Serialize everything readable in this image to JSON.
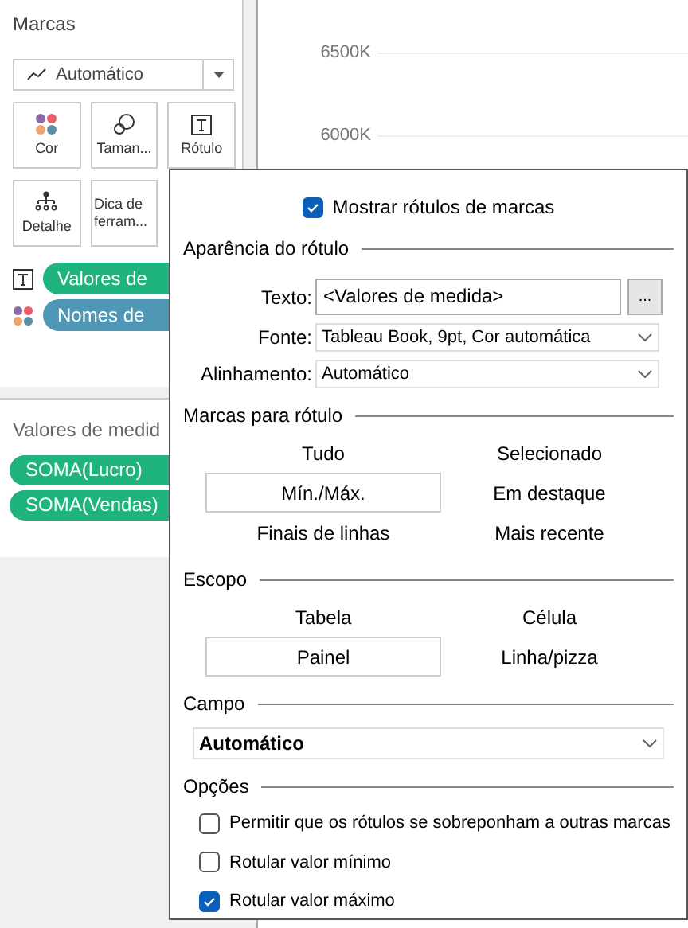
{
  "marks_panel": {
    "title": "Marcas",
    "mark_type": "Automático",
    "cards": [
      {
        "kind": "color",
        "label": "Cor"
      },
      {
        "kind": "size",
        "label": "Taman..."
      },
      {
        "kind": "label",
        "label": "Rótulo"
      },
      {
        "kind": "detail",
        "label": "Detalhe"
      },
      {
        "kind": "tooltip",
        "label": "Dica de ferram..."
      }
    ],
    "fields": [
      {
        "kind": "label",
        "text": "Valores de",
        "color": "#1fb37e"
      },
      {
        "kind": "color",
        "text": "Nomes de",
        "color": "#4f97b5"
      }
    ]
  },
  "measure_values": {
    "title": "Valores de medid",
    "pills": [
      "SOMA(Lucro)",
      "SOMA(Vendas)"
    ]
  },
  "axis_labels": [
    "6500K",
    "6000K"
  ],
  "popup": {
    "show_labels": {
      "label": "Mostrar rótulos de marcas",
      "checked": true
    },
    "appearance": {
      "title": "Aparência do rótulo",
      "text_label": "Texto:",
      "text_value": "<Valores de medida>",
      "more_button": "...",
      "font_label": "Fonte:",
      "font_value": "Tableau Book, 9pt, Cor automática",
      "align_label": "Alinhamento:",
      "align_value": "Automático"
    },
    "marks_to_label": {
      "title": "Marcas para rótulo",
      "options": [
        {
          "label": "Tudo",
          "selected": false
        },
        {
          "label": "Selecionado",
          "selected": false
        },
        {
          "label": "Mín./Máx.",
          "selected": true
        },
        {
          "label": "Em destaque",
          "selected": false
        },
        {
          "label": "Finais de linhas",
          "selected": false
        },
        {
          "label": "Mais recente",
          "selected": false
        }
      ]
    },
    "scope": {
      "title": "Escopo",
      "options": [
        {
          "label": "Tabela",
          "selected": false
        },
        {
          "label": "Célula",
          "selected": false
        },
        {
          "label": "Painel",
          "selected": true
        },
        {
          "label": "Linha/pizza",
          "selected": false
        }
      ]
    },
    "field": {
      "title": "Campo",
      "value": "Automático"
    },
    "options": {
      "title": "Opções",
      "items": [
        {
          "label": "Permitir que os rótulos se sobreponham a outras marcas",
          "checked": false
        },
        {
          "label": "Rotular valor mínimo",
          "checked": false
        },
        {
          "label": "Rotular valor máximo",
          "checked": true
        }
      ]
    }
  }
}
